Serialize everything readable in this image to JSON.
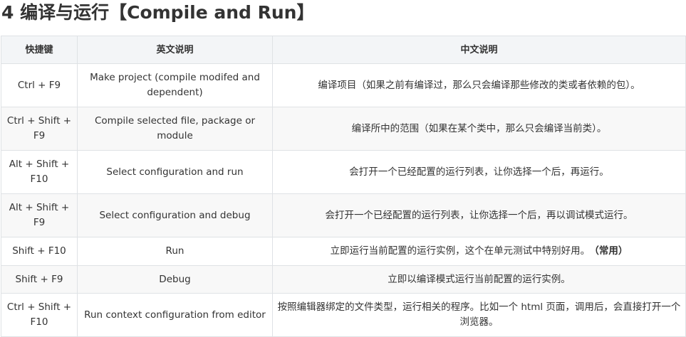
{
  "heading": "4 编译与运行【Compile and Run】",
  "table": {
    "headers": [
      "快捷键",
      "英文说明",
      "中文说明"
    ],
    "rows": [
      {
        "shortcut": "Ctrl + F9",
        "english": "Make project (compile modifed and dependent)",
        "chinese": "编译项目（如果之前有编译过，那么只会编译那些修改的类或者依赖的包）。",
        "note": ""
      },
      {
        "shortcut": "Ctrl + Shift + F9",
        "english": "Compile selected file, package or module",
        "chinese": "编译所中的范围（如果在某个类中，那么只会编译当前类）。",
        "note": ""
      },
      {
        "shortcut": "Alt + Shift + F10",
        "english": "Select configuration and run",
        "chinese": "会打开一个已经配置的运行列表，让你选择一个后，再运行。",
        "note": ""
      },
      {
        "shortcut": "Alt + Shift + F9",
        "english": "Select configuration and debug",
        "chinese": "会打开一个已经配置的运行列表，让你选择一个后，再以调试模式运行。",
        "note": ""
      },
      {
        "shortcut": "Shift + F10",
        "english": "Run",
        "chinese": "立即运行当前配置的运行实例，这个在单元测试中特别好用。",
        "note": "（常用）"
      },
      {
        "shortcut": "Shift + F9",
        "english": "Debug",
        "chinese": "立即以编译模式运行当前配置的运行实例。",
        "note": ""
      },
      {
        "shortcut": "Ctrl + Shift + F10",
        "english": "Run context configuration from editor",
        "chinese": "按照编辑器绑定的文件类型，运行相关的程序。比如一个 html 页面，调用后，会直接打开一个浏览器。",
        "note": ""
      }
    ]
  }
}
